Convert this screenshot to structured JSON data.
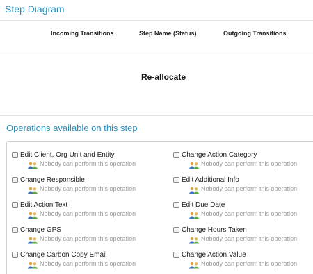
{
  "header": {
    "title": "Step Diagram"
  },
  "columns": {
    "incoming": "Incoming Transitions",
    "step_name": "Step Name (Status)",
    "outgoing": "Outgoing Transitions"
  },
  "step": {
    "name": "Re-allocate"
  },
  "operations": {
    "title": "Operations available on this step",
    "left": [
      {
        "label": "Edit Client, Org Unit and Entity",
        "permission": "Nobody can perform this operation",
        "checked": false
      },
      {
        "label": "Change Responsible",
        "permission": "Nobody can perform this operation",
        "checked": false
      },
      {
        "label": "Edit Action Text",
        "permission": "Nobody can perform this operation",
        "checked": false
      },
      {
        "label": "Change GPS",
        "permission": "Nobody can perform this operation",
        "checked": false
      },
      {
        "label": "Change Carbon Copy Email",
        "permission": "Nobody can perform this operation",
        "checked": false
      }
    ],
    "right": [
      {
        "label": "Change Action Category",
        "permission": "Nobody can perform this operation",
        "checked": false
      },
      {
        "label": "Edit Additional Info",
        "permission": "Nobody can perform this operation",
        "checked": false
      },
      {
        "label": "Edit Due Date",
        "permission": "Nobody can perform this operation",
        "checked": false
      },
      {
        "label": "Change Hours Taken",
        "permission": "Nobody can perform this operation",
        "checked": false
      },
      {
        "label": "Change Action Value",
        "permission": "Nobody can perform this operation",
        "checked": false
      }
    ],
    "icon": "people-icon"
  }
}
